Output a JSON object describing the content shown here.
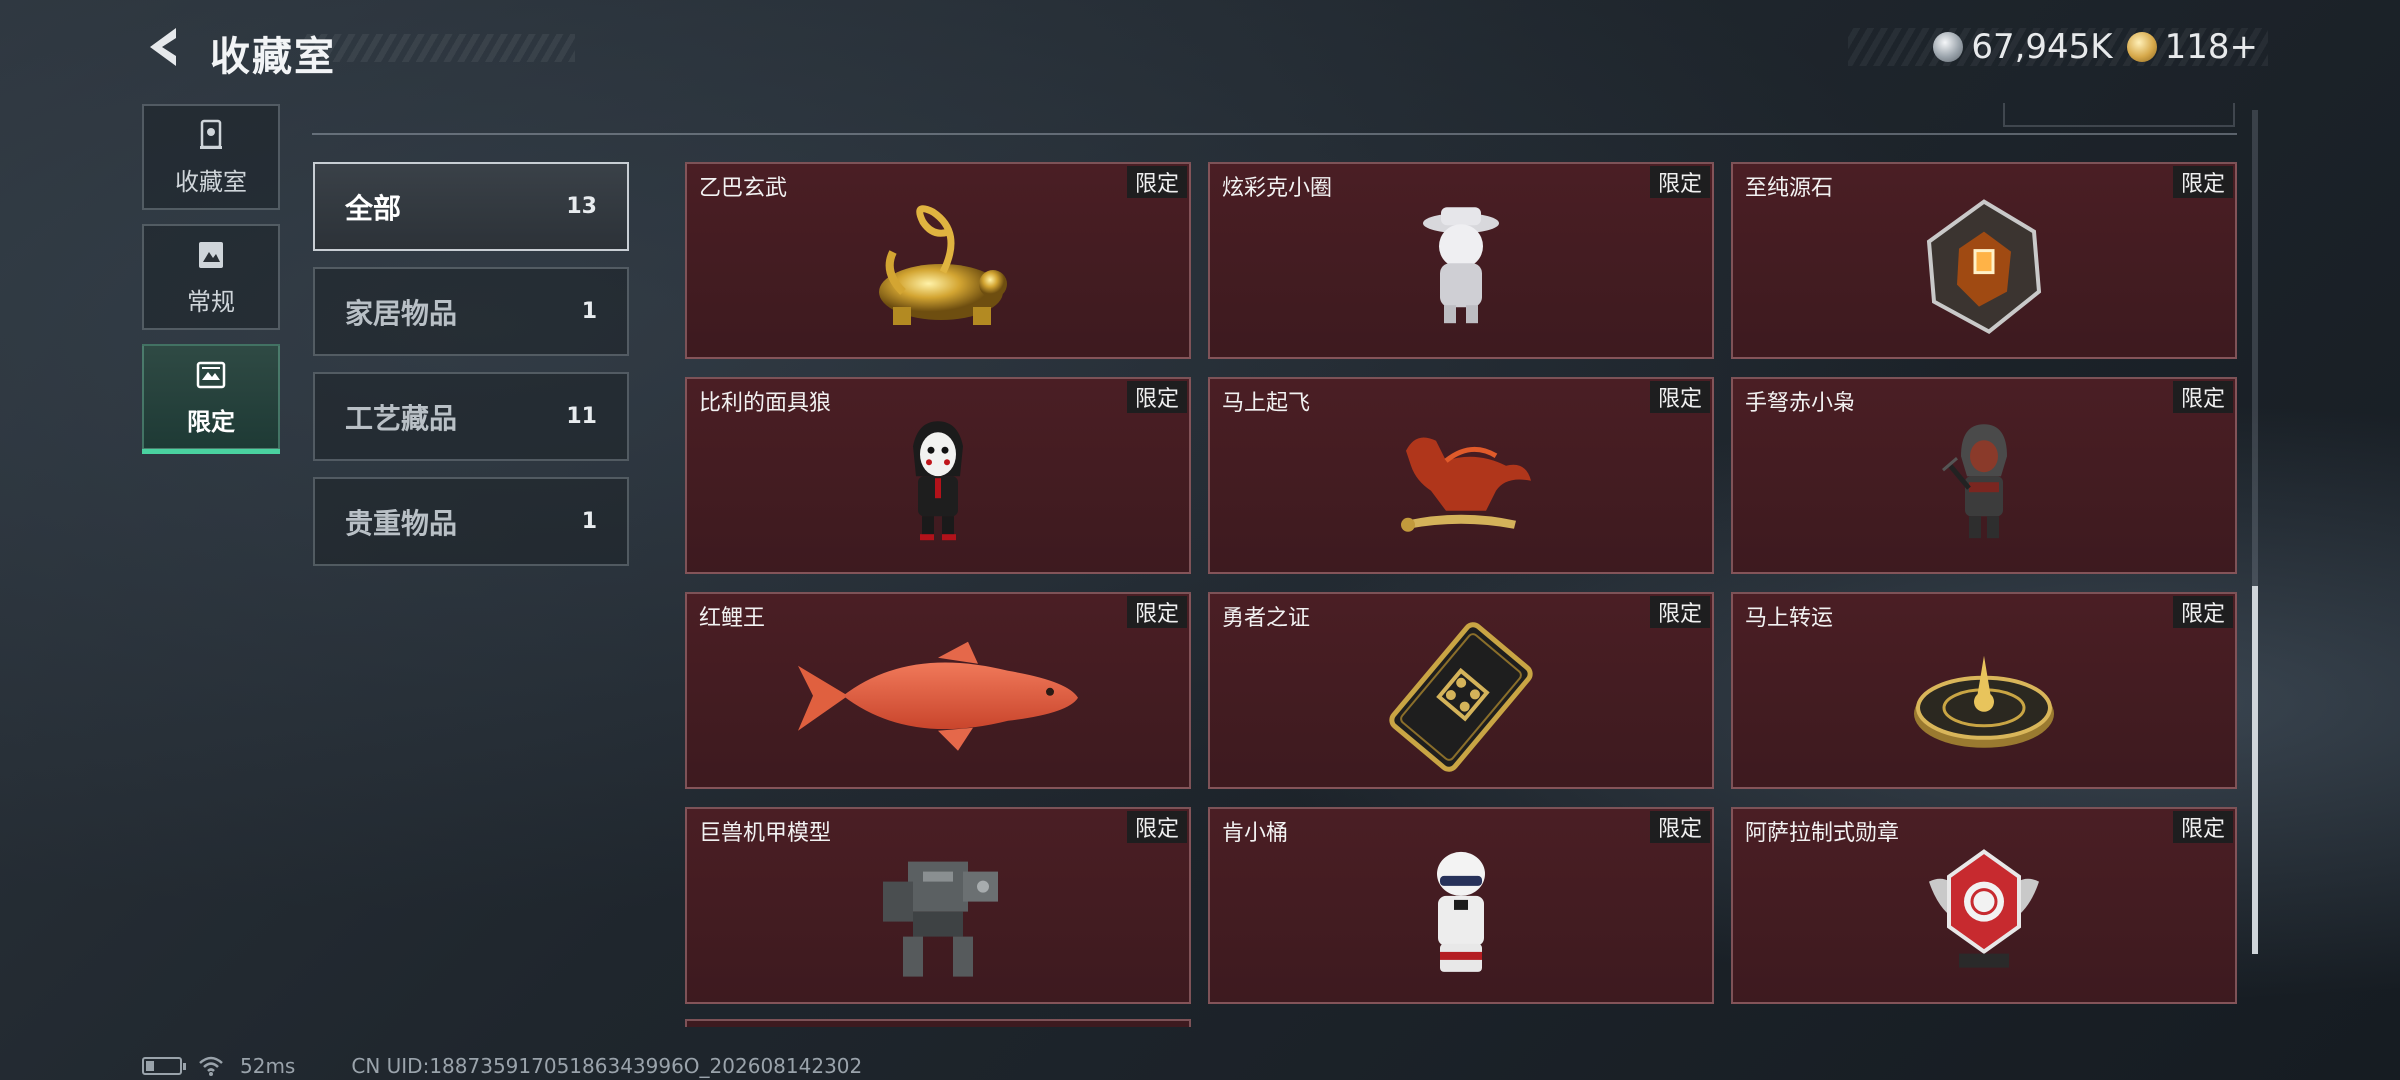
{
  "header": {
    "title": "收藏室",
    "currencies": [
      {
        "icon": "silver-coin-icon",
        "value": "67,945K"
      },
      {
        "icon": "gold-triangle-coin-icon",
        "value": "118+"
      }
    ]
  },
  "side_nav": {
    "items": [
      {
        "label": "收藏室",
        "icon": "collection-icon",
        "active": false
      },
      {
        "label": "常规",
        "icon": "regular-icon",
        "active": false
      },
      {
        "label": "限定",
        "icon": "limited-icon",
        "active": true
      }
    ]
  },
  "categories": [
    {
      "name": "全部",
      "count": "13",
      "active": true
    },
    {
      "name": "家居物品",
      "count": "1",
      "active": false
    },
    {
      "name": "工艺藏品",
      "count": "11",
      "active": false
    },
    {
      "name": "贵重物品",
      "count": "1",
      "active": false
    }
  ],
  "items": [
    {
      "name": "乙巴玄武",
      "badge": "限定",
      "icon": "golden-tortoise-snake-icon"
    },
    {
      "name": "炫彩克小圈",
      "badge": "限定",
      "icon": "silver-figure-hat-icon"
    },
    {
      "name": "至纯源石",
      "badge": "限定",
      "icon": "source-stone-crystal-icon"
    },
    {
      "name": "比利的面具狼",
      "badge": "限定",
      "icon": "billy-puppet-figure-icon"
    },
    {
      "name": "马上起飞",
      "badge": "限定",
      "icon": "flying-horse-icon"
    },
    {
      "name": "手弩赤小枭",
      "badge": "限定",
      "icon": "crossbow-hooded-figure-icon"
    },
    {
      "name": "红鲤王",
      "badge": "限定",
      "icon": "red-carp-icon"
    },
    {
      "name": "勇者之证",
      "badge": "限定",
      "icon": "brave-card-icon"
    },
    {
      "name": "马上转运",
      "badge": "限定",
      "icon": "fortune-wheel-icon"
    },
    {
      "name": "巨兽机甲模型",
      "badge": "限定",
      "icon": "mech-model-icon"
    },
    {
      "name": "肯小桶",
      "badge": "限定",
      "icon": "colonel-bust-icon"
    },
    {
      "name": "阿萨拉制式勋章",
      "badge": "限定",
      "icon": "asara-medal-icon"
    }
  ],
  "status_bar": {
    "ping": "52ms",
    "uid": "CN UID:18873591705186343996O_202608142302"
  },
  "colors": {
    "card_bg": "#3d1a1f",
    "active_accent": "#4ad2a0"
  }
}
